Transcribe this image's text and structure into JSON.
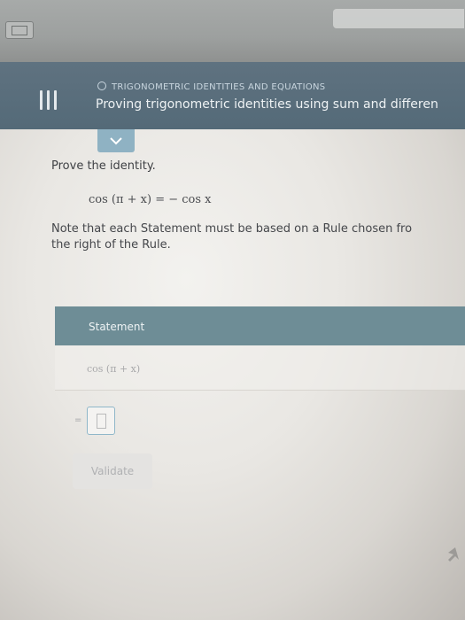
{
  "header": {
    "topic": "TRIGONOMETRIC IDENTITIES AND EQUATIONS",
    "lesson_title": "Proving trigonometric identities using sum and differen"
  },
  "problem": {
    "prompt": "Prove the identity.",
    "identity": "cos (π + x) = − cos x",
    "note_line1": "Note that each Statement must be based on a Rule chosen fro",
    "note_line2": "the right of the Rule."
  },
  "table": {
    "column_statement": "Statement",
    "first_statement": "cos (π + x)",
    "equals": "="
  },
  "buttons": {
    "validate": "Validate"
  },
  "icons": {
    "menu": "menu-icon",
    "chevron": "chevron-down-icon",
    "tab": "tab-icon",
    "circle": "circle-icon",
    "cursor": "cursor-icon"
  },
  "colors": {
    "header_bg": "#5a6f7d",
    "table_header_bg": "#6e8d96",
    "chevron_tab_bg": "#8fb2c3"
  }
}
